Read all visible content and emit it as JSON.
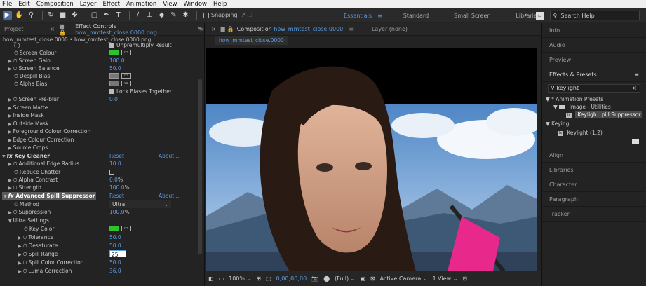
{
  "menu": [
    "File",
    "Edit",
    "Composition",
    "Layer",
    "Effect",
    "Animation",
    "View",
    "Window",
    "Help"
  ],
  "toolbar": {
    "snapping_label": "Snapping",
    "workspaces": [
      "Essentials",
      "Standard",
      "Small Screen",
      "Libraries"
    ],
    "active_workspace": "Essentials",
    "search_help_placeholder": "Search Help"
  },
  "left_panel": {
    "tab_project": "Project",
    "tab_effect_controls_prefix": "Effect Controls",
    "tab_effect_controls_file": "how_mmtest_close.0000.png",
    "layer_path": "how_mmtest_close.0000 • how_mmtest_close.0000.png",
    "rows": {
      "unpremultiply": "Unpremultiply Result",
      "screen_colour": "Screen Colour",
      "screen_gain": "Screen Gain",
      "screen_gain_val": "100.0",
      "screen_balance": "Screen Balance",
      "screen_balance_val": "50.0",
      "despill_bias": "Despill Bias",
      "alpha_bias": "Alpha Bias",
      "lock_biases": "Lock Biases Together",
      "screen_preblur": "Screen Pre-blur",
      "screen_preblur_val": "0.0",
      "screen_matte": "Screen Matte",
      "inside_mask": "Inside Mask",
      "outside_mask": "Outside Mask",
      "fg_colour_corr": "Foreground Colour Correction",
      "edge_colour_corr": "Edge Colour Correction",
      "source_crops": "Source Crops",
      "key_cleaner": "Key Cleaner",
      "reset": "Reset",
      "about": "About...",
      "additional_edge_radius": "Additional Edge Radius",
      "additional_edge_radius_val": "10.0",
      "reduce_chatter": "Reduce Chatter",
      "alpha_contrast": "Alpha Contrast",
      "alpha_contrast_val": "0.0",
      "alpha_contrast_unit": "%",
      "strength": "Strength",
      "strength_val": "100.0",
      "strength_unit": "%",
      "adv_spill": "Advanced Spill Suppressor",
      "method": "Method",
      "method_val": "Ultra",
      "suppression": "Suppression",
      "suppression_val": "100.0",
      "suppression_unit": "%",
      "ultra_settings": "Ultra Settings",
      "key_color": "Key Color",
      "tolerance": "Tolerance",
      "tolerance_val": "50.0",
      "desaturate": "Desaturate",
      "desaturate_val": "50.0",
      "spill_range": "Spill Range",
      "spill_range_val": "25",
      "spill_color_correction": "Spill Color Correction",
      "spill_color_correction_val": "50.0",
      "luma_correction": "Luma Correction",
      "luma_correction_val": "36.0"
    }
  },
  "comp_panel": {
    "tab_prefix": "Composition",
    "tab_file": "how_mmtest_close.0000",
    "layer_none": "Layer (none)",
    "comp_tab": "how_mmtest_close.0000",
    "footer": {
      "zoom": "100%",
      "timecode": "0;00;00;00",
      "resolution": "(Full)",
      "camera": "Active Camera",
      "views": "1 View"
    }
  },
  "right_panel": {
    "info": "Info",
    "audio": "Audio",
    "preview": "Preview",
    "effects_presets": "Effects & Presets",
    "search_value": "keylight",
    "animation_presets": "* Animation Presets",
    "image_utilities": "Image - Utilities",
    "keylight_preset": "Keyligh...pill Suppressor",
    "keying": "Keying",
    "keylight_effect": "Keylight (1.2)",
    "align": "Align",
    "libraries": "Libraries",
    "character": "Character",
    "paragraph": "Paragraph",
    "tracker": "Tracker"
  },
  "colors": {
    "accent": "#5b9be0",
    "key_green": "#2ec22e",
    "flag_pink": "#e8288a"
  }
}
